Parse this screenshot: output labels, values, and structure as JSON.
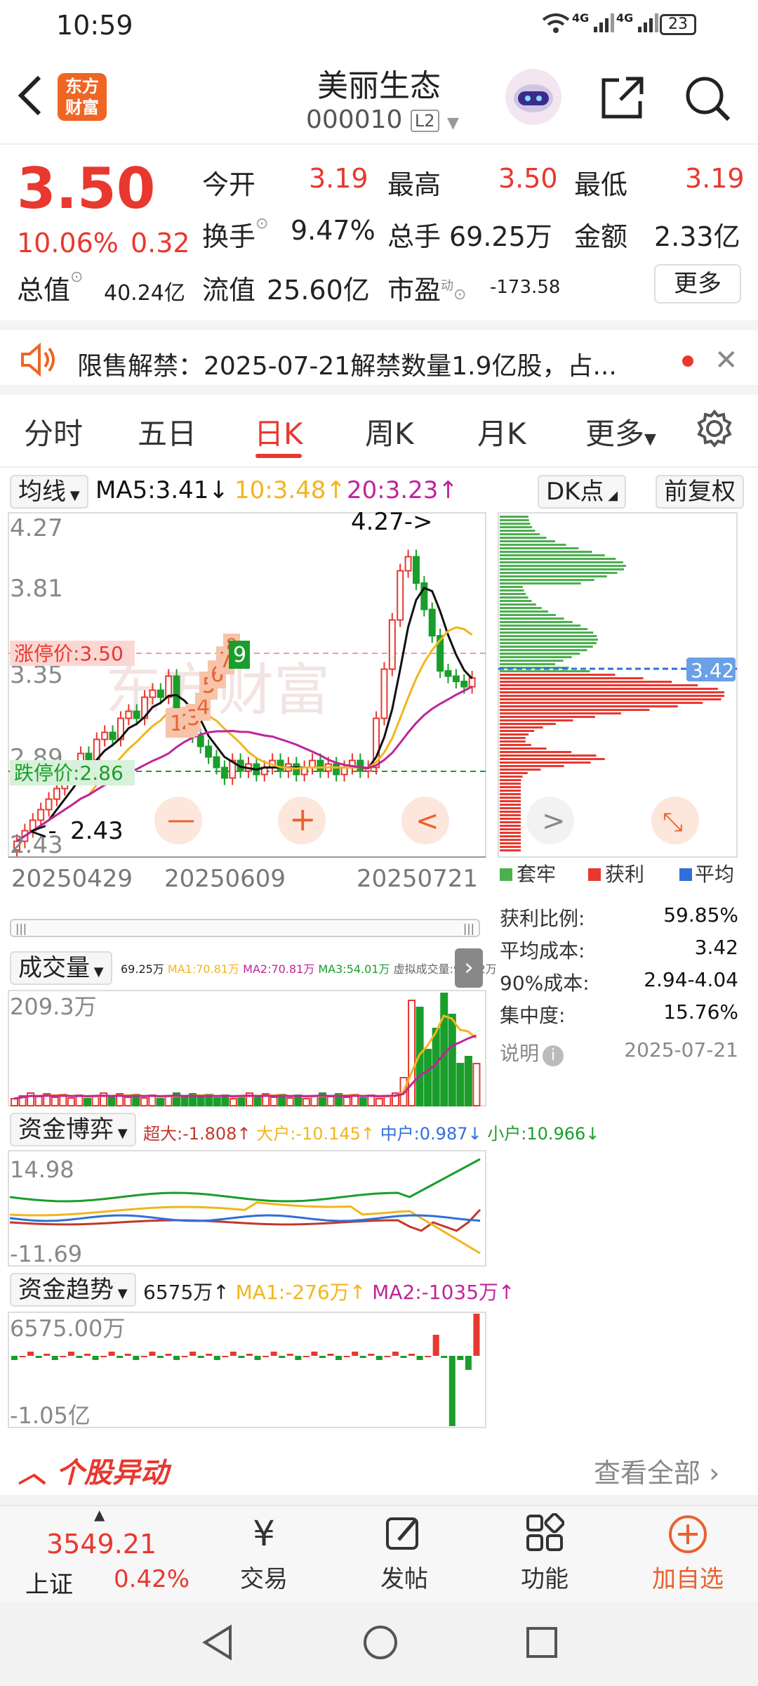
{
  "status": {
    "time": "10:59",
    "net1": "4G",
    "net2": "4G",
    "battery": "23"
  },
  "header": {
    "logo_line1": "东方",
    "logo_line2": "财富",
    "name": "美丽生态",
    "code": "000010",
    "level": "L2"
  },
  "quote": {
    "price": "3.50",
    "pct": "10.06%",
    "chg": "0.32",
    "open_label": "今开",
    "open": "3.19",
    "high_label": "最高",
    "high": "3.50",
    "low_label": "最低",
    "low": "3.19",
    "turnover_label": "换手",
    "turnover": "9.47%",
    "volume_label": "总手",
    "volume": "69.25万",
    "amount_label": "金额",
    "amount": "2.33亿",
    "mktcap_label": "总值",
    "mktcap": "40.24亿",
    "float_label": "流值",
    "float": "25.60亿",
    "pe_label": "市盈",
    "pe_sup": "动",
    "pe": "-173.58",
    "more": "更多"
  },
  "notice": {
    "text": "限售解禁：2025-07-21解禁数量1.9亿股，占..."
  },
  "tabs": [
    "分时",
    "五日",
    "日K",
    "周K",
    "月K",
    "更多"
  ],
  "ma": {
    "selector": "均线",
    "ma5": "MA5:3.41↓",
    "ma10": "10:3.48↑",
    "ma20": "20:3.23↑",
    "dk": "DK点",
    "adjust": "前复权"
  },
  "kline": {
    "y_labels": [
      "4.27",
      "3.81",
      "3.35",
      "2.89",
      "2.43"
    ],
    "high_tag": "4.27->",
    "low_tag": "2.43",
    "limit_up": "涨停价:3.50",
    "limit_down": "跌停价:2.86",
    "x_labels": [
      "20250429",
      "20250609",
      "20250721"
    ],
    "seq_marks": [
      "1",
      "2",
      "3",
      "4",
      "5",
      "6",
      "7",
      "8",
      "9"
    ],
    "watermark": "东方财富"
  },
  "chips": {
    "price_tag": "3.42",
    "legend": [
      "套牢",
      "获利",
      "平均"
    ],
    "stats": [
      {
        "label": "获利比例:",
        "value": "59.85%"
      },
      {
        "label": "平均成本:",
        "value": "3.42"
      },
      {
        "label": "90%成本:",
        "value": "2.94-4.04"
      },
      {
        "label": "集中度:",
        "value": "15.76%"
      }
    ],
    "note_label": "说明",
    "date": "2025-07-21"
  },
  "volume": {
    "selector": "成交量",
    "v": "69.25万",
    "ma1": "MA1:70.81万",
    "ma2": "MA2:70.81万",
    "ma3": "MA3:54.01万",
    "virtual": "虚拟成交量:94.82万",
    "top": "209.3万"
  },
  "funds": {
    "selector": "资金博弈",
    "super": "超大:-1.808↑",
    "big": "大户:-10.145↑",
    "mid": "中户:0.987↓",
    "small": "小户:10.966↓",
    "top": "14.98",
    "bottom": "-11.69"
  },
  "trend": {
    "selector": "资金趋势",
    "v": "6575万↑",
    "ma1": "MA1:-276万↑",
    "ma2": "MA2:-1035万↑",
    "top": "6575.00万",
    "bottom": "-1.05亿"
  },
  "movement": {
    "title": "个股异动",
    "view_all": "查看全部"
  },
  "bottom": {
    "index_value": "3549.21",
    "index_name": "上证",
    "index_pct": "0.42%",
    "trade": "交易",
    "post": "发帖",
    "func": "功能",
    "add": "加自选"
  },
  "colors": {
    "up": "#e8382f",
    "down": "#1a9e2b",
    "accent": "#e8382f",
    "ma5": "#111111",
    "ma10": "#f2b51c",
    "ma20": "#c0249a"
  }
}
